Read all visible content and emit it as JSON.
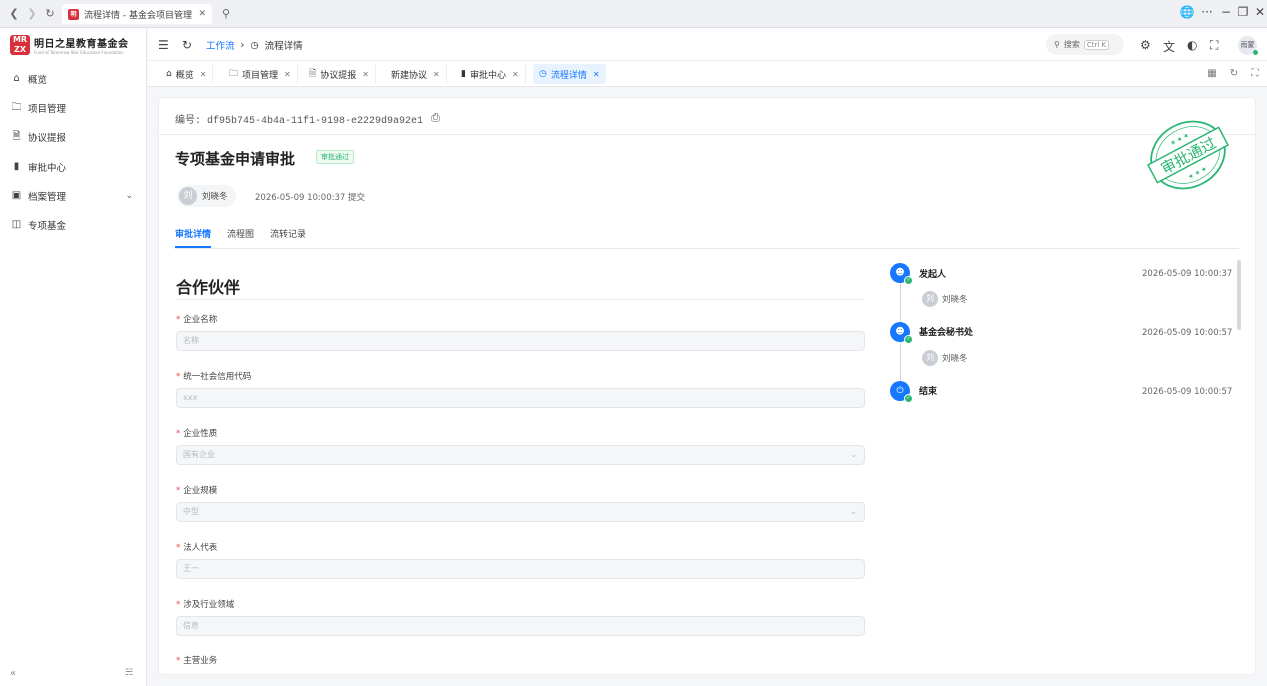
{
  "browser": {
    "tab_title": "流程详情 - 基金会项目管理系",
    "tab_favicon": "明"
  },
  "sidebar": {
    "logo_mark": "MR ZX",
    "logo_name": "明日之星教育基金会",
    "logo_en": "Fund of Tomorrow Star Education Foundation",
    "items": [
      {
        "label": "概览",
        "icon": "home-icon"
      },
      {
        "label": "项目管理",
        "icon": "folder-icon"
      },
      {
        "label": "协议提报",
        "icon": "document-icon"
      },
      {
        "label": "审批中心",
        "icon": "clipboard-icon"
      },
      {
        "label": "档案管理",
        "icon": "archive-icon"
      },
      {
        "label": "专项基金",
        "icon": "fund-icon"
      }
    ]
  },
  "header": {
    "breadcrumb_root": "工作流",
    "breadcrumb_current": "流程详情",
    "search_placeholder": "搜索",
    "search_shortcut": "Ctrl K",
    "user_avatar": "雨蒙"
  },
  "tabs": [
    {
      "label": "概览",
      "active": false
    },
    {
      "label": "项目管理",
      "active": false
    },
    {
      "label": "协议提报",
      "active": false
    },
    {
      "label": "新建协议",
      "active": false
    },
    {
      "label": "审批中心",
      "active": false
    },
    {
      "label": "流程详情",
      "active": true
    }
  ],
  "process": {
    "serial": "编号: df95b745-4b4a-11f1-9198-e2229d9a92e1",
    "title": "专项基金申请审批",
    "status": "审批通过",
    "stamp_text": "审批通过",
    "submitter_avatar": "刘",
    "submitter_name": "刘晓冬",
    "submit_info": "2026-05-09 10:00:37 提交",
    "detail_tabs": [
      "审批详情",
      "流程图",
      "流转记录"
    ]
  },
  "form": {
    "section_title": "合作伙伴",
    "fields": [
      {
        "label": "企业名称",
        "value": "名称",
        "type": "input"
      },
      {
        "label": "统一社会信用代码",
        "value": "xxx",
        "type": "input"
      },
      {
        "label": "企业性质",
        "value": "国有企业",
        "type": "select"
      },
      {
        "label": "企业规模",
        "value": "中型",
        "type": "select"
      },
      {
        "label": "法人代表",
        "value": "王一",
        "type": "input"
      },
      {
        "label": "涉及行业领域",
        "value": "信息",
        "type": "input"
      },
      {
        "label": "主营业务",
        "value": "",
        "type": "input"
      }
    ]
  },
  "timeline": [
    {
      "title": "发起人",
      "time": "2026-05-09 10:00:37",
      "user": "刘晓冬",
      "user_avatar": "刘",
      "icon": "user-icon"
    },
    {
      "title": "基金会秘书处",
      "time": "2026-05-09 10:00:57",
      "user": "刘晓冬",
      "user_avatar": "刘",
      "icon": "user-icon"
    },
    {
      "title": "结束",
      "time": "2026-05-09 10:00:57",
      "user": "",
      "user_avatar": "",
      "icon": "power-icon"
    }
  ],
  "colors": {
    "accent": "#1677ff",
    "success": "#2bb673",
    "brand": "#d9303b",
    "required": "#e5484d"
  }
}
